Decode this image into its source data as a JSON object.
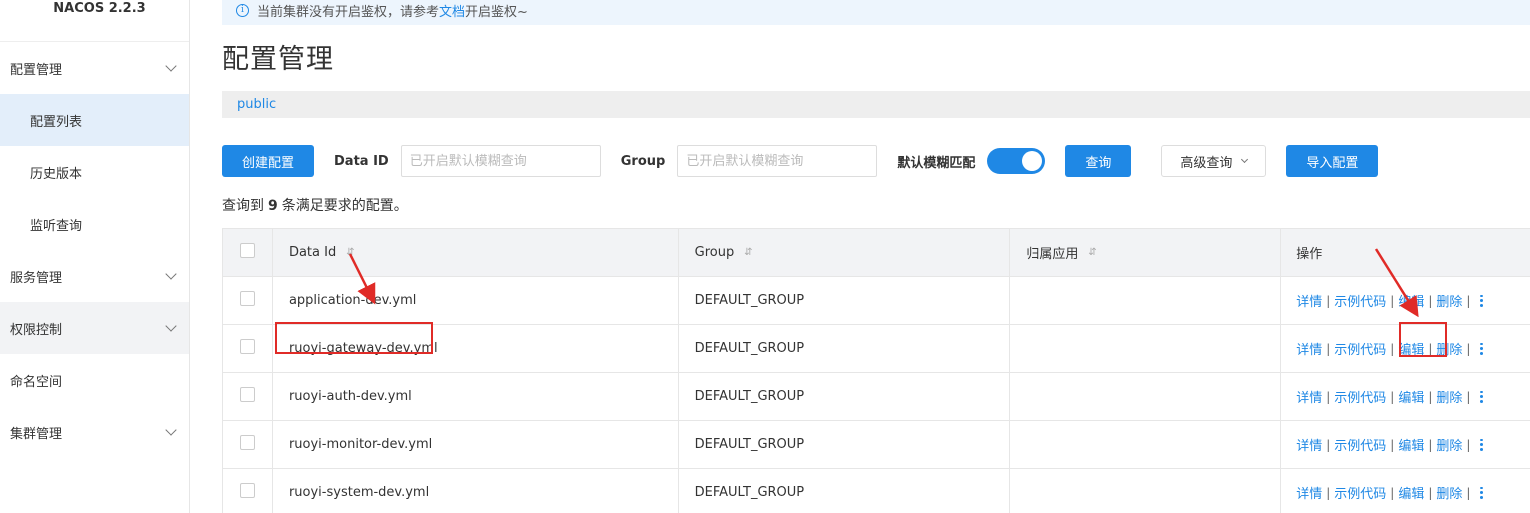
{
  "brand": "NACOS 2.2.3",
  "sidebar": {
    "items": [
      {
        "label": "配置管理",
        "type": "group"
      },
      {
        "label": "配置列表",
        "type": "sub"
      },
      {
        "label": "历史版本",
        "type": "sub"
      },
      {
        "label": "监听查询",
        "type": "sub"
      },
      {
        "label": "服务管理",
        "type": "group"
      },
      {
        "label": "权限控制",
        "type": "group"
      },
      {
        "label": "命名空间",
        "type": "group"
      },
      {
        "label": "集群管理",
        "type": "group"
      }
    ]
  },
  "notice": {
    "prefix": "当前集群没有开启鉴权，请参考",
    "link": "文档",
    "suffix": "开启鉴权~"
  },
  "page_title": "配置管理",
  "namespace": "public",
  "toolbar": {
    "create_label": "创建配置",
    "dataid_label": "Data ID",
    "dataid_placeholder": "已开启默认模糊查询",
    "group_label": "Group",
    "group_placeholder": "已开启默认模糊查询",
    "fuzzy_label": "默认模糊匹配",
    "fuzzy_on": true,
    "search_label": "查询",
    "advanced_label": "高级查询",
    "import_label": "导入配置"
  },
  "result": {
    "prefix": "查询到",
    "count": "9",
    "suffix": "条满足要求的配置。"
  },
  "table": {
    "headers": {
      "data_id": "Data Id",
      "group": "Group",
      "app": "归属应用",
      "ops": "操作"
    },
    "ops_labels": {
      "detail": "详情",
      "sample": "示例代码",
      "edit": "编辑",
      "delete": "删除",
      "sep": "|"
    },
    "rows": [
      {
        "data_id": "application-dev.yml",
        "group": "DEFAULT_GROUP",
        "app": ""
      },
      {
        "data_id": "ruoyi-gateway-dev.yml",
        "group": "DEFAULT_GROUP",
        "app": ""
      },
      {
        "data_id": "ruoyi-auth-dev.yml",
        "group": "DEFAULT_GROUP",
        "app": ""
      },
      {
        "data_id": "ruoyi-monitor-dev.yml",
        "group": "DEFAULT_GROUP",
        "app": ""
      },
      {
        "data_id": "ruoyi-system-dev.yml",
        "group": "DEFAULT_GROUP",
        "app": ""
      }
    ]
  },
  "colors": {
    "primary": "#1f88e5",
    "annotation": "#e02b27"
  }
}
